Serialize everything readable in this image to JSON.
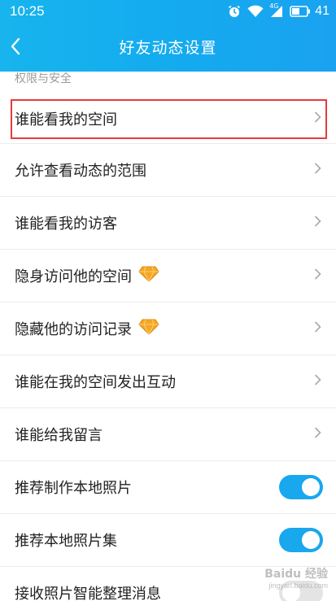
{
  "status_bar": {
    "time": "10:25",
    "network": "4G",
    "battery": "41"
  },
  "nav": {
    "title": "好友动态设置"
  },
  "section": {
    "title": "权限与安全"
  },
  "items": [
    {
      "label": "谁能看我的空间",
      "control": "chevron",
      "highlighted": true
    },
    {
      "label": "允许查看动态的范围",
      "control": "chevron"
    },
    {
      "label": "谁能看我的访客",
      "control": "chevron"
    },
    {
      "label": "隐身访问他的空间",
      "control": "chevron",
      "badge": "diamond-icon"
    },
    {
      "label": "隐藏他的访问记录",
      "control": "chevron",
      "badge": "diamond-icon"
    },
    {
      "label": "谁能在我的空间发出互动",
      "control": "chevron"
    },
    {
      "label": "谁能给我留言",
      "control": "chevron"
    },
    {
      "label": "推荐制作本地照片",
      "control": "toggle",
      "on": true
    },
    {
      "label": "推荐本地照片集",
      "control": "toggle",
      "on": true
    },
    {
      "label": "接收照片智能整理消息",
      "control": "toggle",
      "on": false
    }
  ],
  "watermark": {
    "title": "Baidu 经验",
    "subtitle": "jingyan.baidu.com"
  },
  "colors": {
    "header": "#14abef",
    "accent": "#19a7ee",
    "highlight": "#e53b3b",
    "diamond": "#f5a623"
  }
}
